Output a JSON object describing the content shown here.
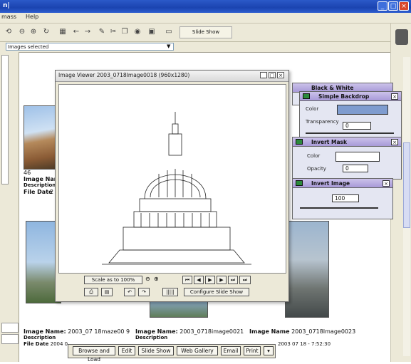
{
  "window": {
    "title": "n|"
  },
  "menu": {
    "item1": "mass",
    "item2": "Help"
  },
  "toolbar": {
    "slideshow_button": "Slide Show",
    "address": "Images selected"
  },
  "thumbnails": [
    {
      "size": "46",
      "name_label": "Image Name",
      "desc_label": "Description",
      "file_label": "File Date",
      "file_value": "2"
    },
    {
      "name_label": "Image Name:",
      "name_value": "2003_07 18maze00 9",
      "desc_label": "Description",
      "file_label": "File Date",
      "file_value": "2004 0"
    },
    {
      "name_label": "Image Name:",
      "name_value": "2003_0718image0021",
      "desc_label": "Description"
    },
    {
      "name_label": "Image Name",
      "name_value": "2003_0718Image0023",
      "file_value": "2003 07 18 - 7:52:30"
    }
  ],
  "viewer": {
    "title": "Image Viewer 2003_0718Image0018 (960x1280)",
    "scale": "Scale as to 100%",
    "configure_button": "Configure Slide Show",
    "nav_counter": "|||||"
  },
  "effects": {
    "black_white": {
      "title": "Black & White"
    },
    "simple_backdrop": {
      "title": "Simple Backdrop",
      "color_label": "Color",
      "transparency_label": "Transparency",
      "transparency_value": "0"
    },
    "invert_mask": {
      "title": "Invert Mask",
      "color_label": "Color",
      "opacity_label": "Opacity",
      "opacity_value": "0"
    },
    "invert_image": {
      "title": "Invert Image",
      "value": "100"
    }
  },
  "bottombar": {
    "browse": "Browse and Load",
    "edit": "Edit",
    "slideshow": "Slide Show",
    "webgallery": "Web Gallery",
    "email": "Email",
    "print": "Print"
  }
}
